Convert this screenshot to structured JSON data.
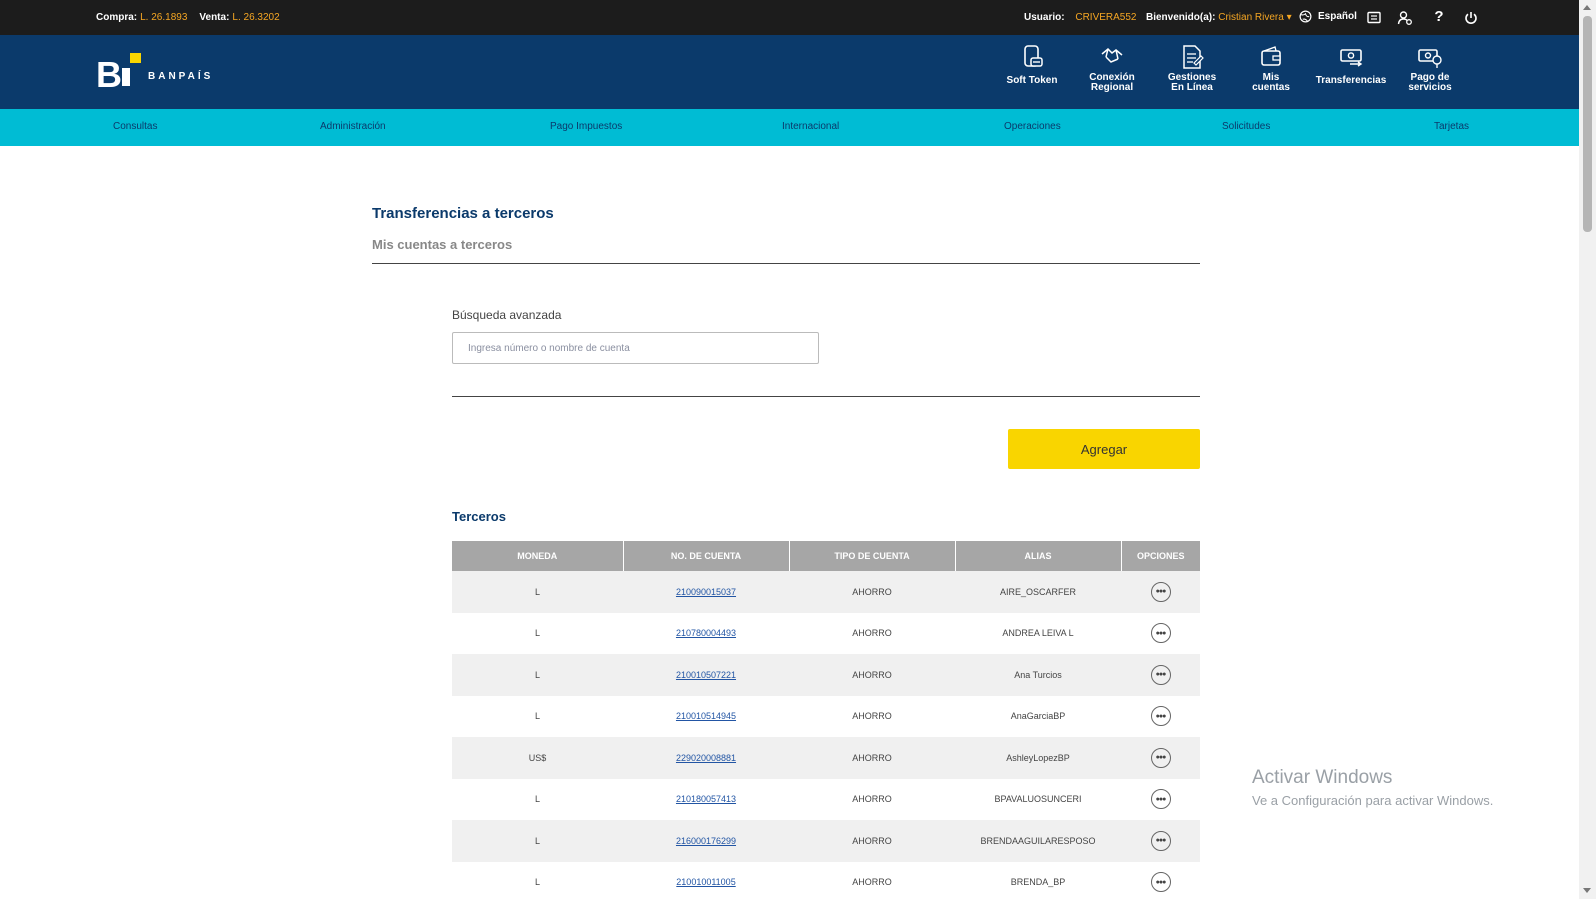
{
  "topbar": {
    "buy_label": "Compra:",
    "buy_value": "L. 26.1893",
    "sell_label": "Venta:",
    "sell_value": "L. 26.3202",
    "user_label": "Usuario:",
    "user_value": "CRIVERA552",
    "welcome_label": "Bienvenido(a):",
    "welcome_value": "Cristian Rivera",
    "language": "Español"
  },
  "header": {
    "logo_text": "BANPAÍS",
    "quicknav": [
      {
        "line1": "Soft Token",
        "line2": "",
        "icon": "phone-token-icon"
      },
      {
        "line1": "Conexión",
        "line2": "Regional",
        "icon": "regional-connection-icon"
      },
      {
        "line1": "Gestiones",
        "line2": "En Línea",
        "icon": "online-document-icon"
      },
      {
        "line1": "Mis",
        "line2": "cuentas",
        "icon": "wallet-icon"
      },
      {
        "line1": "Transferencias",
        "line2": "",
        "icon": "transfer-icon"
      },
      {
        "line1": "Pago de",
        "line2": "servicios",
        "icon": "service-payment-icon"
      }
    ]
  },
  "mainnav": [
    "Consultas",
    "Administración",
    "Pago Impuestos",
    "Internacional",
    "Operaciones",
    "Solicitudes",
    "Tarjetas"
  ],
  "content": {
    "title": "Transferencias a terceros",
    "subtitle": "Mis cuentas a terceros",
    "search_label": "Búsqueda avanzada",
    "search_placeholder": "Ingresa número o nombre de cuenta",
    "add_button": "Agregar",
    "section_title": "Terceros"
  },
  "table": {
    "columns": [
      "MONEDA",
      "NO. DE CUENTA",
      "TIPO DE CUENTA",
      "ALIAS",
      "OPCIONES"
    ],
    "rows": [
      {
        "currency": "L",
        "account": "210090015037",
        "type": "AHORRO",
        "alias": "AIRE_OSCARFER"
      },
      {
        "currency": "L",
        "account": "210780004493",
        "type": "AHORRO",
        "alias": "ANDREA LEIVA L"
      },
      {
        "currency": "L",
        "account": "210010507221",
        "type": "AHORRO",
        "alias": "Ana Turcios"
      },
      {
        "currency": "L",
        "account": "210010514945",
        "type": "AHORRO",
        "alias": "AnaGarciaBP"
      },
      {
        "currency": "US$",
        "account": "229020008881",
        "type": "AHORRO",
        "alias": "AshleyLopezBP"
      },
      {
        "currency": "L",
        "account": "210180057413",
        "type": "AHORRO",
        "alias": "BPAVALUOSUNCERI"
      },
      {
        "currency": "L",
        "account": "216000176299",
        "type": "AHORRO",
        "alias": "BRENDAAGUILARESPOSO"
      },
      {
        "currency": "L",
        "account": "210010011005",
        "type": "AHORRO",
        "alias": "BRENDA_BP"
      }
    ]
  },
  "watermark": {
    "title": "Activar Windows",
    "subtitle": "Ve a Configuración para activar Windows."
  },
  "colors": {
    "header": "#0b3a6b",
    "nav": "#00bcd4",
    "accent": "#f9d500",
    "topbar": "#1c1c1c",
    "highlight": "#f5a623"
  }
}
